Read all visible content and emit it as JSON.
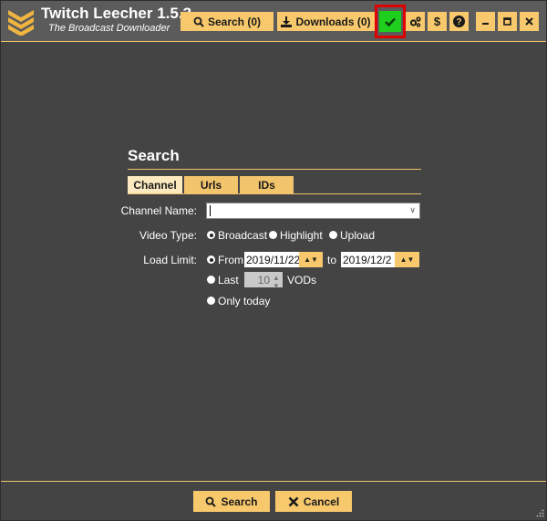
{
  "app": {
    "title": "Twitch Leecher 1.5.3",
    "subtitle": "The Broadcast Downloader"
  },
  "toolbar": {
    "search_label": "Search (0)",
    "downloads_label": "Downloads (0)",
    "status_icon": "check-icon",
    "settings_icon": "gears-icon",
    "donate_icon": "dollar-icon",
    "help_icon": "question-icon",
    "minimize_icon": "minimize-icon",
    "maximize_icon": "maximize-icon",
    "close_icon": "close-icon"
  },
  "search": {
    "title": "Search",
    "tabs": [
      {
        "label": "Channel",
        "active": true
      },
      {
        "label": "Urls",
        "active": false
      },
      {
        "label": "IDs",
        "active": false
      }
    ],
    "channel_name_label": "Channel Name:",
    "channel_name_value": "",
    "video_type_label": "Video Type:",
    "video_types": [
      {
        "label": "Broadcast",
        "checked": true
      },
      {
        "label": "Highlight",
        "checked": false
      },
      {
        "label": "Upload",
        "checked": false
      }
    ],
    "load_limit_label": "Load Limit:",
    "from_label": "From",
    "from_date": "2019/11/22",
    "to_label": "to",
    "to_date": "2019/12/2",
    "last_label": "Last",
    "last_count": "10",
    "vods_label": "VODs",
    "only_today_label": "Only today"
  },
  "bottom": {
    "search_label": "Search",
    "cancel_label": "Cancel"
  },
  "colors": {
    "accent": "#f7c86c",
    "background": "#444444",
    "titlebar": "#5b5b5b",
    "status_ok": "#1ecf1e",
    "highlight_frame": "#e10000"
  }
}
